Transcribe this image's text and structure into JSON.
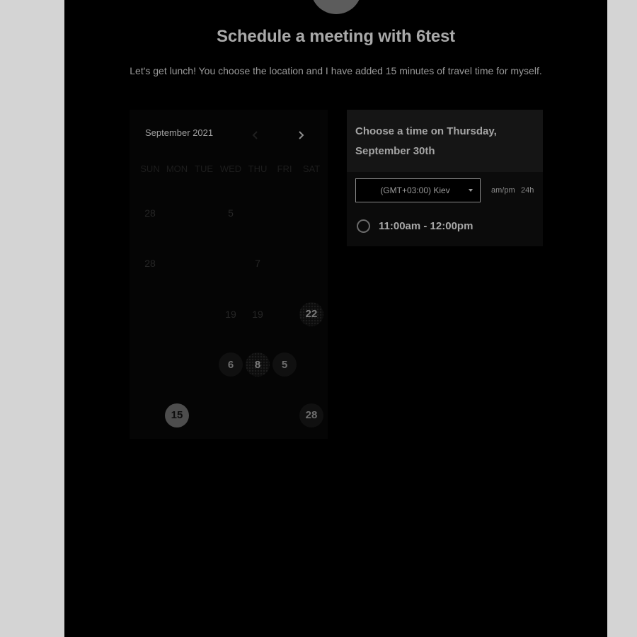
{
  "header": {
    "title": "Schedule a meeting with 6test",
    "description": "Let's get lunch! You choose the location and I have added 15 minutes of travel time for myself."
  },
  "calendar": {
    "month_label": "September 2021",
    "prev_icon": "chevron-left-icon",
    "next_icon": "chevron-right-icon",
    "weekdays": [
      "SUN",
      "MON",
      "TUE",
      "WED",
      "THU",
      "FRI",
      "SAT"
    ],
    "days": [
      {
        "label": "28",
        "state": "dim"
      },
      {
        "label": "",
        "state": "empty"
      },
      {
        "label": "",
        "state": "empty"
      },
      {
        "label": "5",
        "state": "dim"
      },
      {
        "label": "",
        "state": "empty"
      },
      {
        "label": "",
        "state": "empty"
      },
      {
        "label": "",
        "state": "empty"
      },
      {
        "label": "28",
        "state": "dim"
      },
      {
        "label": "",
        "state": "empty"
      },
      {
        "label": "",
        "state": "empty"
      },
      {
        "label": "",
        "state": "empty"
      },
      {
        "label": "7",
        "state": "dim"
      },
      {
        "label": "",
        "state": "empty"
      },
      {
        "label": "",
        "state": "empty"
      },
      {
        "label": "",
        "state": "empty"
      },
      {
        "label": "",
        "state": "empty"
      },
      {
        "label": "",
        "state": "empty"
      },
      {
        "label": "19",
        "state": "dim"
      },
      {
        "label": "19",
        "state": "dim"
      },
      {
        "label": "",
        "state": "empty"
      },
      {
        "label": "22",
        "state": "dotted"
      },
      {
        "label": "",
        "state": "empty"
      },
      {
        "label": "",
        "state": "empty"
      },
      {
        "label": "",
        "state": "empty"
      },
      {
        "label": "6",
        "state": "avail"
      },
      {
        "label": "8",
        "state": "dotted"
      },
      {
        "label": "5",
        "state": "avail"
      },
      {
        "label": "",
        "state": "empty"
      },
      {
        "label": "",
        "state": "empty"
      },
      {
        "label": "15",
        "state": "selected"
      },
      {
        "label": "",
        "state": "empty"
      },
      {
        "label": "",
        "state": "empty"
      },
      {
        "label": "",
        "state": "empty"
      },
      {
        "label": "",
        "state": "empty"
      },
      {
        "label": "28",
        "state": "avail"
      }
    ]
  },
  "times": {
    "heading": "Choose a time on Thursday, September 30th",
    "timezone": "(GMT+03:00) Kiev",
    "format_ampm": "am/pm",
    "format_24h": "24h",
    "slots": [
      {
        "label": "11:00am - 12:00pm"
      }
    ]
  },
  "colors": {
    "background": "#d4d4d4",
    "panel": "#000000",
    "title_text": "#a9a9a9"
  }
}
